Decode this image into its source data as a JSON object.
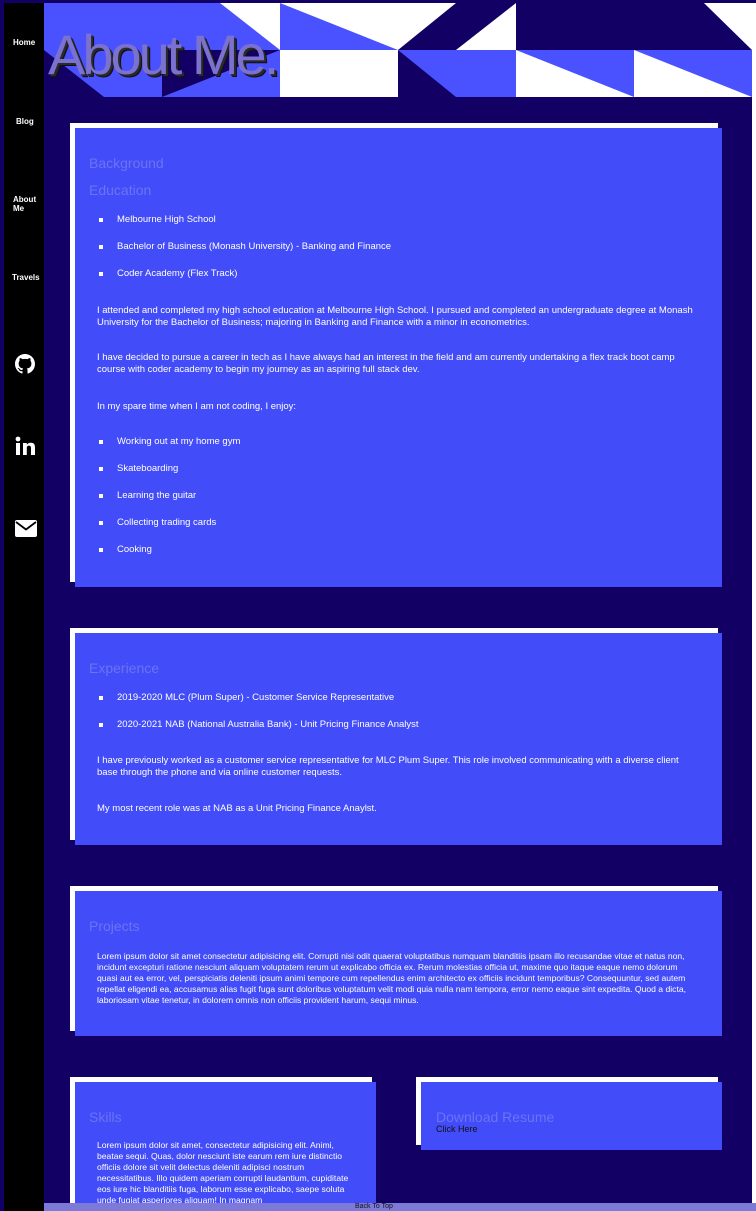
{
  "nav": {
    "items": [
      {
        "label": "Home"
      },
      {
        "label": "Blog"
      },
      {
        "label": "About Me"
      },
      {
        "label": "Travels"
      }
    ],
    "social": [
      {
        "icon": "github-icon"
      },
      {
        "icon": "linkedin-icon"
      },
      {
        "icon": "envelope-icon"
      }
    ]
  },
  "hero": {
    "title": "About Me."
  },
  "background": {
    "heading": "Background",
    "subheading": "Education",
    "education": [
      "Melbourne High School",
      "Bachelor of Business (Monash University) - Banking and Finance",
      "Coder Academy (Flex Track)"
    ],
    "para1": "I attended and completed my high school education at Melbourne High School. I pursued and completed an undergraduate degree at Monash University for the Bachelor of Business; majoring in Banking and Finance with a minor in econometrics.",
    "para2": "I have decided to pursue a career in tech as I have always had an interest in the field and am currently undertaking a flex track boot camp course with coder academy to begin my journey as an aspiring full stack dev.",
    "para3": "In my spare time when I am not coding, I enjoy:",
    "hobbies": [
      "Working out at my home gym",
      "Skateboarding",
      "Learning the guitar",
      "Collecting trading cards",
      "Cooking"
    ]
  },
  "experience": {
    "heading": "Experience",
    "jobs": [
      "2019-2020 MLC (Plum Super) - Customer Service Representative",
      "2020-2021 NAB (National Australia Bank) - Unit Pricing Finance Analyst"
    ],
    "para1": "I have previously worked as a customer service representative for MLC Plum Super. This role involved communicating with a diverse client base through the phone and via online customer requests.",
    "para2": "My most recent role was at NAB as a Unit Pricing Finance Anaylst."
  },
  "projects": {
    "heading": "Projects",
    "text": "Lorem ipsum dolor sit amet consectetur adipisicing elit. Corrupti nisi odit quaerat voluptatibus numquam blanditiis ipsam illo recusandae vitae et natus non, incidunt excepturi ratione nesciunt aliquam voluptatem rerum ut explicabo officia ex. Rerum molestias officia ut, maxime quo itaque eaque nemo dolorum quasi aut ea error, vel, perspiciatis deleniti ipsum animi tempore cum repellendus enim architecto ex officiis incidunt temporibus? Consequuntur, sed autem repellat eligendi ea, accusamus alias fugit fuga sunt doloribus voluptatum velit modi quia nulla nam tempora, error nemo eaque sint expedita. Quod a dicta, laboriosam vitae tenetur, in dolorem omnis non officiis provident harum, sequi minus."
  },
  "skills": {
    "heading": "Skills",
    "text": "Lorem ipsum dolor sit amet, consectetur adipisicing elit. Animi, beatae sequi. Quas, dolor nesciunt iste earum rem iure distinctio officiis dolore sit velit delectus deleniti adipisci nostrum necessitatibus. Illo quidem aperiam corrupti laudantium, cupiditate eos iure hic blanditiis fuga, laborum esse explicabo, saepe soluta unde fugiat asperiores aliquam! In magnam"
  },
  "resume": {
    "heading": "Download Resume",
    "link": "Click Here"
  },
  "footer": {
    "back_to_top": "Back To Top"
  },
  "colors": {
    "page_bg": "#130064",
    "card_bg": "#424cf8",
    "heading_text": "#6b74f2",
    "sidebar_bg": "#000000"
  }
}
